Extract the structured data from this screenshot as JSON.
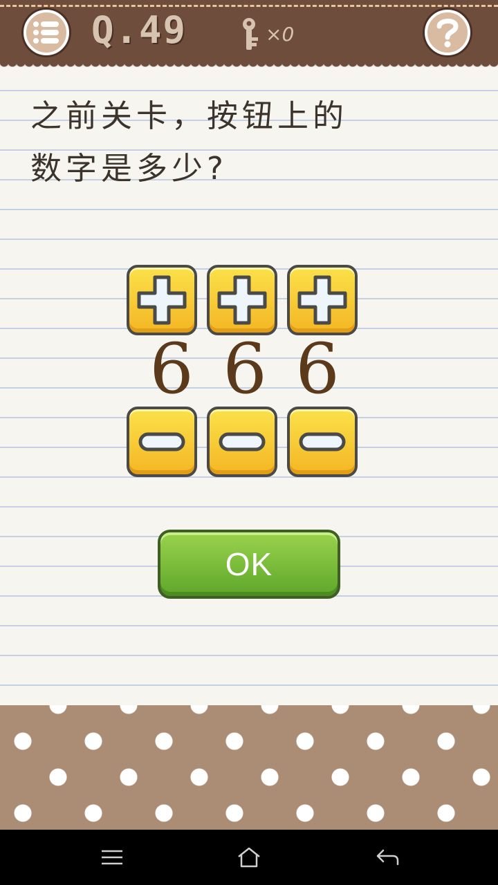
{
  "header": {
    "level_label": "Q.49",
    "key_count_label": "×0"
  },
  "question": {
    "line1": "之前关卡，按钮上的",
    "line2": "数字是多少?"
  },
  "digits": [
    "6",
    "6",
    "6"
  ],
  "ok_label": "OK",
  "colors": {
    "header_brown": "#6f4d3c",
    "button_yellow": "#f4b624",
    "ok_green": "#5ea62a",
    "digit_brown": "#5a3a1a",
    "polka_brown": "#ab8c74"
  },
  "icons": [
    "menu-list-icon",
    "key-icon",
    "help-icon",
    "plus-icon",
    "minus-icon",
    "nav-menu-icon",
    "nav-home-icon",
    "nav-back-icon"
  ]
}
